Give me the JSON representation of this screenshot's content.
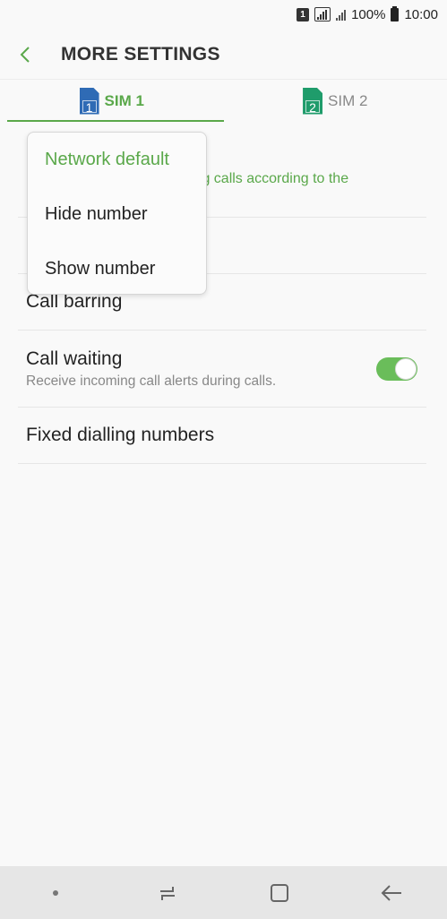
{
  "status_bar": {
    "sim_badge": "1",
    "battery": "100%",
    "time": "10:00"
  },
  "header": {
    "title": "MORE SETTINGS",
    "back_icon": "chevron-left-icon"
  },
  "tabs": [
    {
      "label": "SIM 1",
      "sim_number": "1",
      "active": true,
      "color": "#2f6bb5"
    },
    {
      "label": "SIM 2",
      "sim_number": "2",
      "active": false,
      "color": "#1f9c6b"
    }
  ],
  "settings": {
    "caller_id": {
      "subtitle_fragment": "ing calls according to the"
    },
    "call_barring": {
      "title": "Call barring"
    },
    "call_waiting": {
      "title": "Call waiting",
      "subtitle": "Receive incoming call alerts during calls.",
      "enabled": true
    },
    "fixed_dialling": {
      "title": "Fixed dialling numbers"
    }
  },
  "popup": {
    "options": [
      {
        "label": "Network default",
        "selected": true
      },
      {
        "label": "Hide number",
        "selected": false
      },
      {
        "label": "Show number",
        "selected": false
      }
    ]
  },
  "navbar": {
    "items": [
      "dot-icon",
      "recent-apps-icon",
      "home-icon",
      "back-arrow-icon"
    ]
  },
  "colors": {
    "accent": "#5aa84a",
    "toggle_on": "#6abd5a",
    "background": "#f9f9f9",
    "navbar": "#e6e6e6"
  }
}
